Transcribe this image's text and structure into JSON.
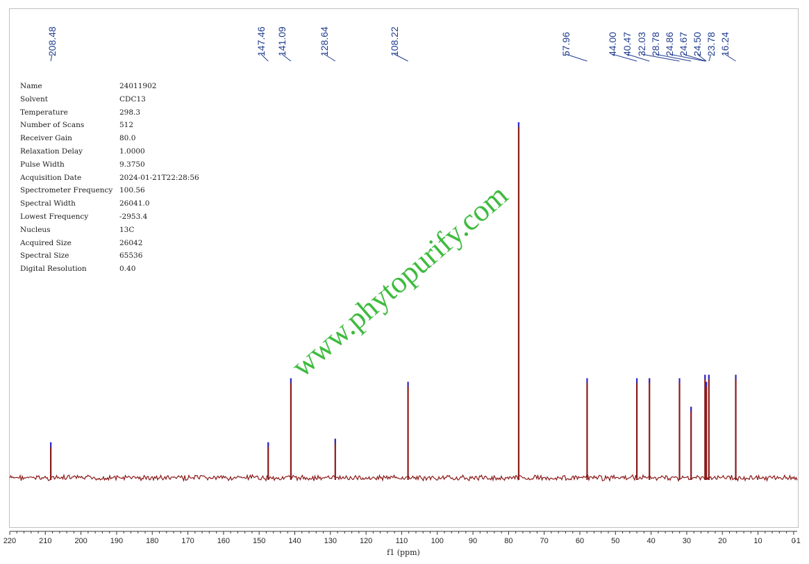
{
  "chart_data": {
    "type": "line",
    "xlabel": "f1 (ppm)",
    "xlim": [
      220,
      -1
    ],
    "x_ticks": [
      220,
      210,
      200,
      190,
      180,
      170,
      160,
      150,
      140,
      130,
      120,
      110,
      100,
      90,
      80,
      70,
      60,
      50,
      40,
      30,
      20,
      10,
      0,
      -1
    ],
    "x_tick_labels": [
      "220",
      "210",
      "200",
      "190",
      "180",
      "170",
      "160",
      "150",
      "140",
      "130",
      "120",
      "110",
      "100",
      "90",
      "80",
      "70",
      "60",
      "50",
      "40",
      "30",
      "20",
      "10",
      "0",
      "-1"
    ],
    "peak_labels": [
      "208.48",
      "147.46",
      "141.09",
      "128.64",
      "108.22",
      "57.96",
      "44.00",
      "40.47",
      "32.03",
      "28.78",
      "24.86",
      "24.67",
      "24.50",
      "23.78",
      "16.24"
    ],
    "peaks": [
      {
        "ppm": 208.48,
        "intensity": 0.1
      },
      {
        "ppm": 147.46,
        "intensity": 0.1
      },
      {
        "ppm": 141.09,
        "intensity": 0.28
      },
      {
        "ppm": 128.64,
        "intensity": 0.11
      },
      {
        "ppm": 108.22,
        "intensity": 0.27
      },
      {
        "ppm": 77.16,
        "intensity": 1.0
      },
      {
        "ppm": 57.96,
        "intensity": 0.28
      },
      {
        "ppm": 44.0,
        "intensity": 0.28
      },
      {
        "ppm": 40.47,
        "intensity": 0.28
      },
      {
        "ppm": 32.03,
        "intensity": 0.28
      },
      {
        "ppm": 28.78,
        "intensity": 0.2
      },
      {
        "ppm": 24.86,
        "intensity": 0.29
      },
      {
        "ppm": 24.67,
        "intensity": 0.26
      },
      {
        "ppm": 24.5,
        "intensity": 0.27
      },
      {
        "ppm": 23.78,
        "intensity": 0.29
      },
      {
        "ppm": 16.24,
        "intensity": 0.29
      }
    ]
  },
  "parameters": [
    {
      "key": "Name",
      "value": "24011902"
    },
    {
      "key": "Solvent",
      "value": "CDC13"
    },
    {
      "key": "Temperature",
      "value": "298.3"
    },
    {
      "key": "Number of Scans",
      "value": "512"
    },
    {
      "key": "Receiver Gain",
      "value": "80.0"
    },
    {
      "key": "Relaxation Delay",
      "value": "1.0000"
    },
    {
      "key": "Pulse Width",
      "value": "9.3750"
    },
    {
      "key": "Acquisition Date",
      "value": "2024-01-21T22:28:56"
    },
    {
      "key": "Spectrometer Frequency",
      "value": "100.56"
    },
    {
      "key": "Spectral Width",
      "value": "26041.0"
    },
    {
      "key": "Lowest Frequency",
      "value": "-2953.4"
    },
    {
      "key": "Nucleus",
      "value": "13C"
    },
    {
      "key": "Acquired Size",
      "value": "26042"
    },
    {
      "key": "Spectral Size",
      "value": "65536"
    },
    {
      "key": "Digital Resolution",
      "value": "0.40"
    }
  ],
  "watermark": "www.phytopurify.com",
  "colors": {
    "spectrum": "#8b1a1a",
    "peak_label": "#1f3b8f",
    "peak_cap": "#2a2ad0",
    "watermark": "#2fb52f",
    "axis": "#333333"
  }
}
